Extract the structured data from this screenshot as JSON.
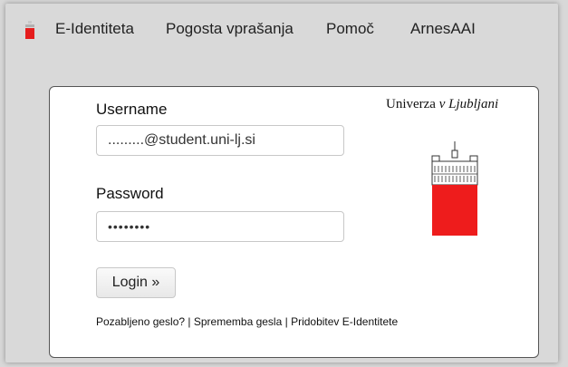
{
  "nav": {
    "items": [
      "E-Identiteta",
      "Pogosta vprašanja",
      "Pomoč",
      "ArnesAAI"
    ],
    "logo_color": "#e51d1d"
  },
  "login": {
    "username_label": "Username",
    "username_value": ".........@student.uni-lj.si",
    "password_label": "Password",
    "password_value": "••••••••",
    "login_button": "Login »",
    "links": [
      "Pozabljeno geslo?",
      "Sprememba gesla",
      "Pridobitev E-Identitete"
    ],
    "separator": " | "
  },
  "brand": {
    "name_regular": "Univerza",
    "name_italic": "v Ljubljani",
    "accent": "#ee1c1c"
  }
}
